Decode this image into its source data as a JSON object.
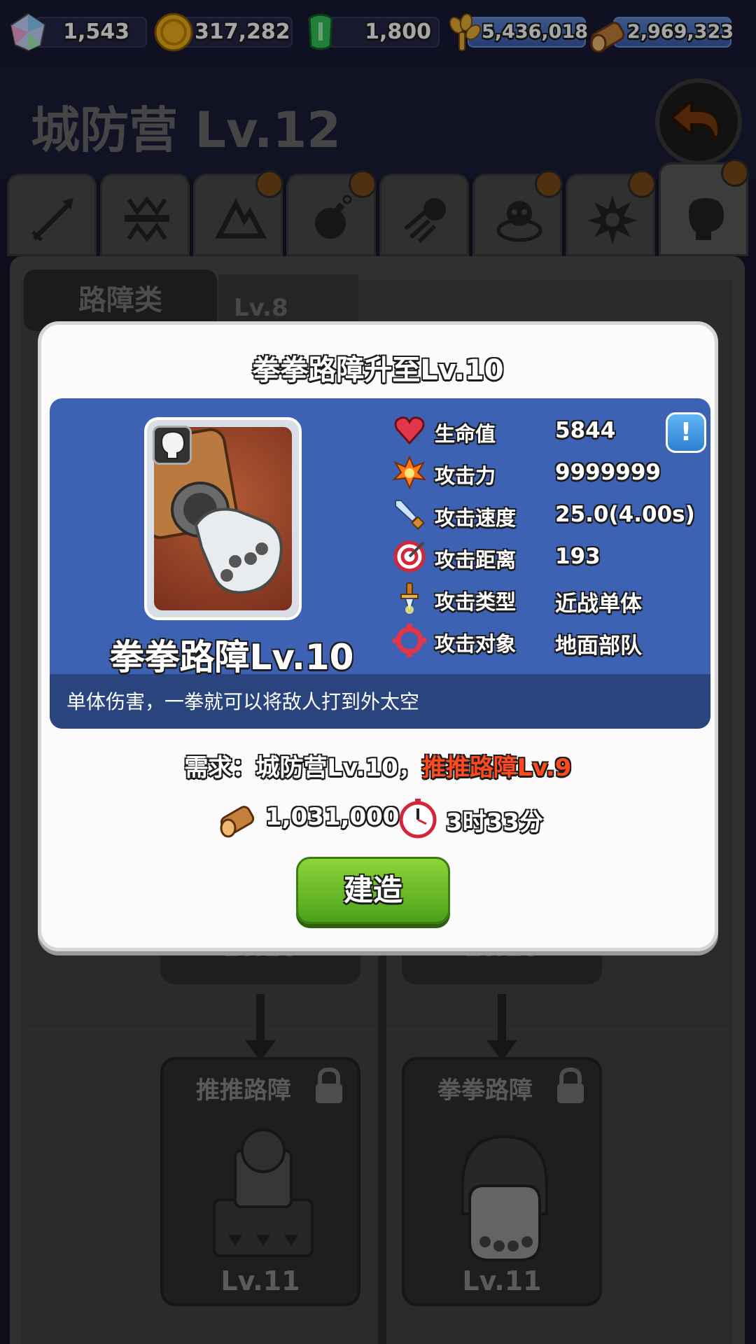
{
  "resources": [
    {
      "icon": "crystal-gem-icon",
      "value": "1,543"
    },
    {
      "icon": "gold-coin-icon",
      "value": "317,282"
    },
    {
      "icon": "green-gem-icon",
      "value": "1,800"
    },
    {
      "icon": "wheat-icon",
      "value": "5,436,018"
    },
    {
      "icon": "wood-log-icon",
      "value": "2,969,323"
    }
  ],
  "header": {
    "title": "城防营 Lv.12"
  },
  "tabs": [
    {
      "icon": "arrow-icon",
      "dot": false
    },
    {
      "icon": "barricade-icon",
      "dot": false
    },
    {
      "icon": "spike-trap-icon",
      "dot": true
    },
    {
      "icon": "bomb-icon",
      "dot": true
    },
    {
      "icon": "cannonball-icon",
      "dot": false
    },
    {
      "icon": "skull-icon",
      "dot": true
    },
    {
      "icon": "sun-star-icon",
      "dot": true
    },
    {
      "icon": "boxing-glove-icon",
      "dot": true,
      "active": true
    }
  ],
  "subtab": {
    "label": "路障类",
    "level": "Lv.8"
  },
  "tree": {
    "stub_left": "Lv.10",
    "stub_right": "Lv.10",
    "cards": [
      {
        "name": "推推路障",
        "level": "Lv.11"
      },
      {
        "name": "拳拳路障",
        "level": "Lv.11"
      }
    ]
  },
  "modal": {
    "title": "拳拳路障升至Lv.10",
    "unit_name": "拳拳路障Lv.10",
    "description": "单体伤害，一拳就可以将敌人打到外太空",
    "info_button": "!",
    "stats": [
      {
        "icon": "heart-icon",
        "label": "生命值",
        "value": "5844"
      },
      {
        "icon": "explosion-icon",
        "label": "攻击力",
        "value": "9999999"
      },
      {
        "icon": "sword-icon",
        "label": "攻击速度",
        "value": "25.0(4.00s)"
      },
      {
        "icon": "target-icon",
        "label": "攻击距离",
        "value": "193"
      },
      {
        "icon": "dagger-icon",
        "label": "攻击类型",
        "value": "近战单体"
      },
      {
        "icon": "crosshair-icon",
        "label": "攻击对象",
        "value": "地面部队"
      }
    ],
    "requirement": {
      "prefix": "需求：",
      "normal": "城防营Lv.10，",
      "unmet": "推推路障Lv.9"
    },
    "cost": {
      "wood": "1,031,000",
      "time": "3时33分"
    },
    "build_label": "建造"
  },
  "colors": {
    "requirement_unmet": "#ff4a1e",
    "build_button": "#6bbf2a",
    "info_panel": "#3e62b3"
  }
}
